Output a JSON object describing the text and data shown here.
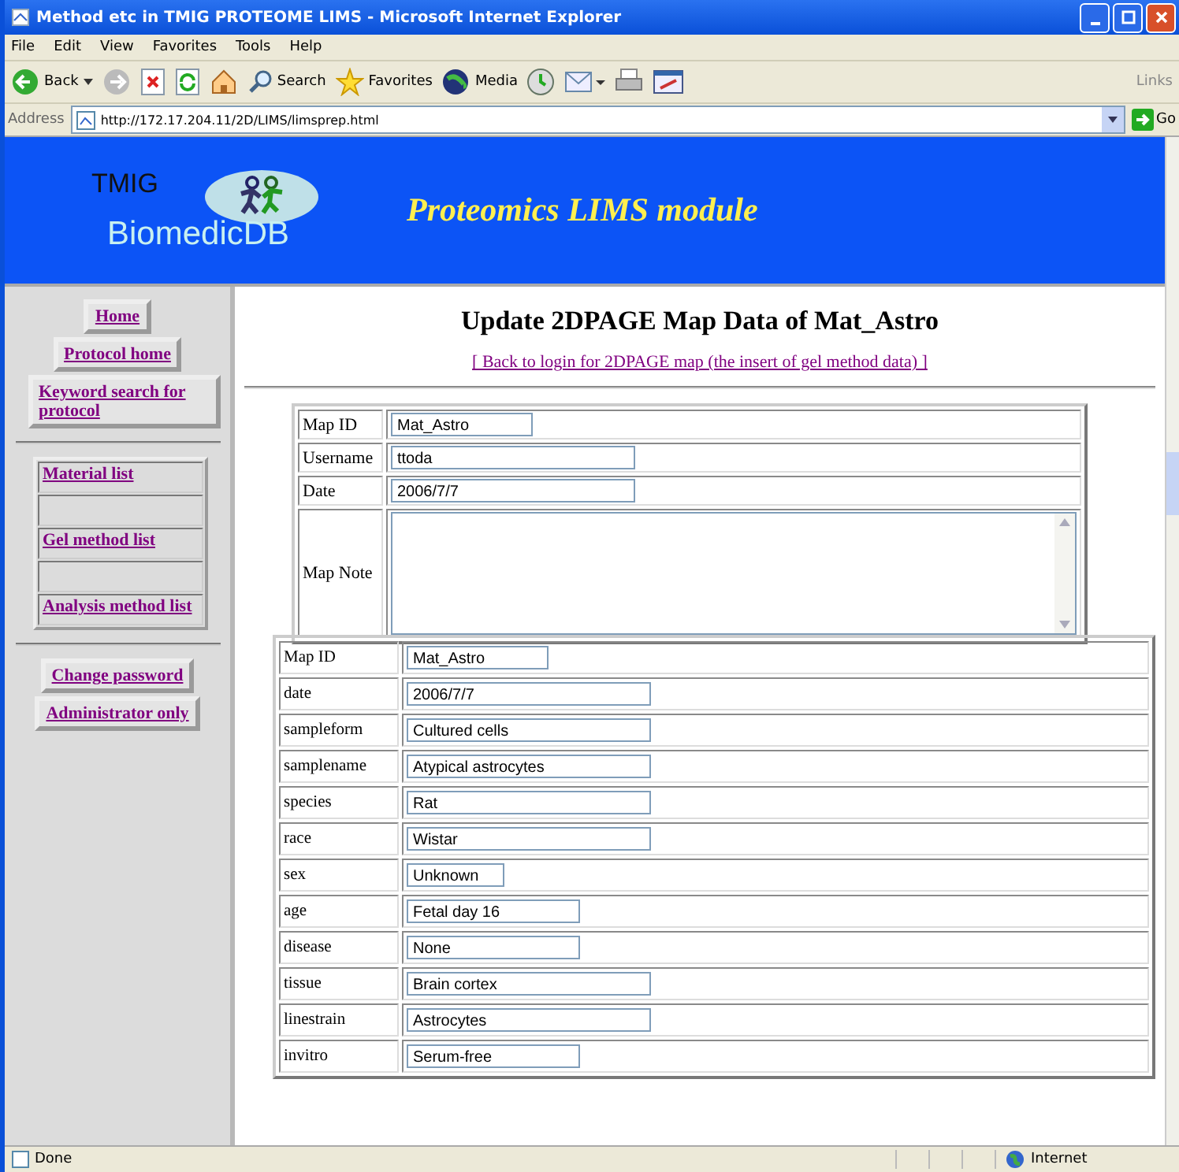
{
  "window": {
    "title": "Method etc in TMIG PROTEOME LIMS - Microsoft Internet Explorer"
  },
  "menu": [
    "File",
    "Edit",
    "View",
    "Favorites",
    "Tools",
    "Help"
  ],
  "toolbar": {
    "back": "Back",
    "search": "Search",
    "favorites": "Favorites",
    "media": "Media",
    "links": "Links"
  },
  "address": {
    "label": "Address",
    "url": "http://172.17.204.11/2D/LIMS/limsprep.html",
    "go": "Go"
  },
  "banner": {
    "logo_top": "TMIG",
    "logo_bottom": "BiomedicDB",
    "title": "Proteomics LIMS module"
  },
  "sidebar": {
    "top_links": [
      "Home",
      "Protocol home",
      "Keyword search for protocol"
    ],
    "list_links": [
      {
        "kind": "link",
        "label": "Material list"
      },
      {
        "kind": "blank"
      },
      {
        "kind": "link",
        "label": "Gel method list"
      },
      {
        "kind": "blank"
      },
      {
        "kind": "link",
        "label": "Analysis method list"
      }
    ],
    "bottom_links": [
      "Change password",
      "Administrator only"
    ]
  },
  "page": {
    "heading": "Update 2DPAGE Map Data of Mat_Astro",
    "back_link": "[ Back to login for 2DPAGE map (the insert of gel method data) ]"
  },
  "map_form": [
    {
      "label": "Map ID",
      "value": "Mat_Astro"
    },
    {
      "label": "Username",
      "value": "ttoda"
    },
    {
      "label": "Date",
      "value": "2006/7/7"
    },
    {
      "label": "Map Note",
      "kind": "textarea"
    }
  ],
  "detail_form": [
    {
      "label": "Map ID",
      "value": "Mat_Astro"
    },
    {
      "label": "date",
      "value": "2006/7/7"
    },
    {
      "label": "sampleform",
      "value": "Cultured cells"
    },
    {
      "label": "samplename",
      "value": "Atypical astrocytes"
    },
    {
      "label": "species",
      "value": "Rat"
    },
    {
      "label": "race",
      "value": "Wistar"
    },
    {
      "label": "sex",
      "value": "Unknown"
    },
    {
      "label": "age",
      "value": "Fetal day 16"
    },
    {
      "label": "disease",
      "value": "None"
    },
    {
      "label": "tissue",
      "value": "Brain cortex"
    },
    {
      "label": "linestrain",
      "value": "Astrocytes"
    },
    {
      "label": "invitro",
      "value": "Serum-free"
    }
  ],
  "status_bar": {
    "text": "Done",
    "zone": "Internet"
  }
}
